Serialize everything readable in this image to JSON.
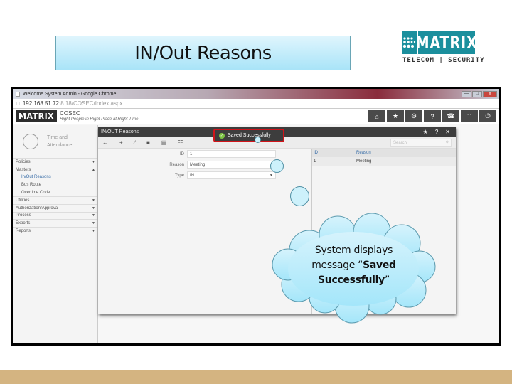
{
  "slide": {
    "title": "IN/Out Reasons",
    "brand": {
      "name": "MATRIX",
      "tagline": "TELECOM | SECURITY",
      "color": "#1b8f9d"
    },
    "callout": {
      "line1": "System displays",
      "line2_plain": "message “",
      "line2_bold": "Saved",
      "line3_bold": "Successfully",
      "line3_end": "”"
    }
  },
  "browser": {
    "window_title": "Welcome System Admin - Google Chrome",
    "url_host": "192.168.51.72",
    "url_path": ":8.18/COSEC/Index.aspx",
    "controls": {
      "minimize": "—",
      "maximize": "□",
      "close": "x"
    }
  },
  "app": {
    "logo": "MATRIX",
    "product": "COSEC",
    "tagline": "Right People in Right Place at Right Time",
    "top_icons": [
      {
        "name": "home-icon",
        "glyph": "⌂"
      },
      {
        "name": "star-icon",
        "glyph": "★"
      },
      {
        "name": "gear-icon",
        "glyph": "⚙"
      },
      {
        "name": "help-icon",
        "glyph": "?"
      },
      {
        "name": "phone-icon",
        "glyph": "☎"
      },
      {
        "name": "org-icon",
        "glyph": "∷"
      },
      {
        "name": "power-icon",
        "glyph": "⏻"
      }
    ]
  },
  "sidebar": {
    "module_line1": "Time and",
    "module_line2": "Attendance",
    "items": [
      {
        "label": "Policies",
        "arrow": "▼"
      },
      {
        "label": "Masters",
        "arrow": "▲"
      },
      {
        "label": "In/Out Reasons",
        "sub": true,
        "active": true
      },
      {
        "label": "Bus Route",
        "sub": true
      },
      {
        "label": "Overtime Code",
        "sub": true
      },
      {
        "label": "Utilities",
        "arrow": "▼"
      },
      {
        "label": "Authorization/Approval",
        "arrow": "▼"
      },
      {
        "label": "Process",
        "arrow": "▼"
      },
      {
        "label": "Exports",
        "arrow": "▼"
      },
      {
        "label": "Reports",
        "arrow": "▼"
      }
    ]
  },
  "window": {
    "title": "IN/OUT Reasons",
    "controls": {
      "pin": "★",
      "help": "?",
      "close": "✕"
    },
    "toolbar": [
      {
        "name": "back-icon",
        "glyph": "←"
      },
      {
        "name": "add-icon",
        "glyph": "+"
      },
      {
        "name": "edit-icon",
        "glyph": "∕"
      },
      {
        "name": "delete-icon",
        "glyph": "■"
      },
      {
        "name": "save-icon",
        "glyph": "▤"
      },
      {
        "name": "list-icon",
        "glyph": "☷"
      }
    ],
    "search_placeholder": "Search",
    "toast": {
      "message": "Saved Successfully",
      "check": "✓"
    },
    "form": {
      "id_label": "ID",
      "id_value": "1",
      "reason_label": "Reason",
      "reason_value": "Meeting",
      "type_label": "Type",
      "type_value": "IN",
      "type_arrow": "▼"
    },
    "grid": {
      "headers": [
        "ID",
        "Reason"
      ],
      "rows": [
        [
          "1",
          "Meeting"
        ]
      ]
    }
  }
}
